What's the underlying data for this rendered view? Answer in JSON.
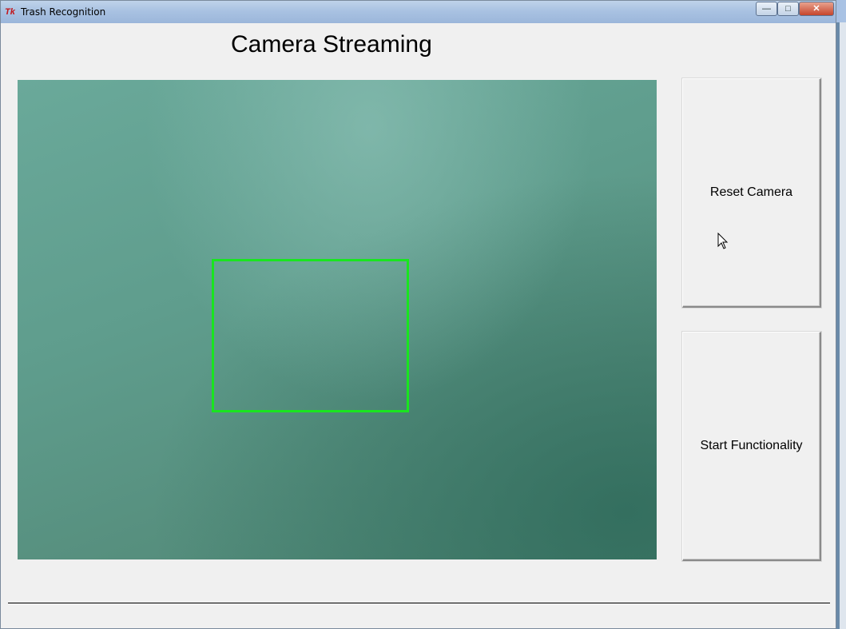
{
  "window": {
    "title": "Trash Recognition",
    "app_icon": "Tk",
    "controls": {
      "minimize": "—",
      "maximize": "□",
      "close": "✕"
    }
  },
  "main": {
    "heading": "Camera Streaming",
    "camera_feed": {
      "detection_box_color": "#19e51f"
    }
  },
  "buttons": {
    "reset_camera": "Reset Camera",
    "start_functionality": "Start Functionality"
  }
}
